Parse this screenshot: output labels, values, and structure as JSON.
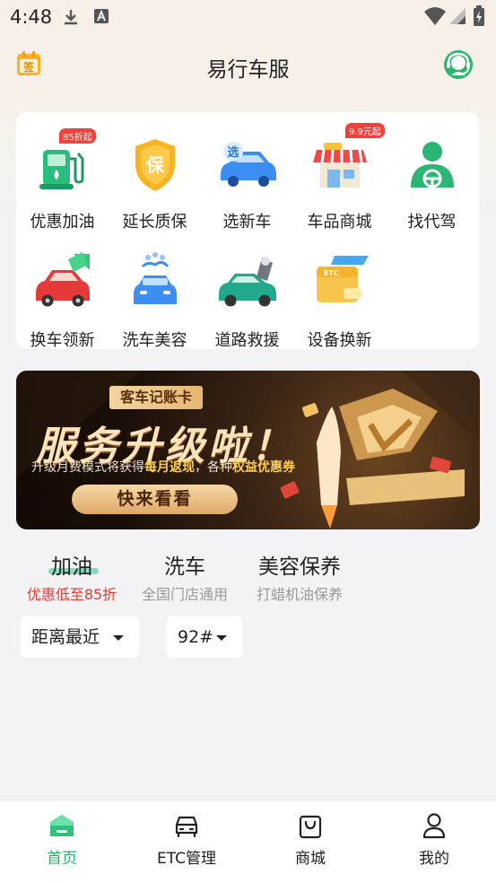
{
  "status_bar": {
    "time": "4:48"
  },
  "header": {
    "title": "易行车服",
    "checkin_icon_text": "签"
  },
  "services": [
    {
      "label": "优惠加油",
      "tag": "85折起",
      "icon": "gas-pump-icon"
    },
    {
      "label": "延长质保",
      "tag": "",
      "icon": "shield-icon",
      "glyph": "保"
    },
    {
      "label": "选新车",
      "tag": "",
      "icon": "new-car-icon",
      "glyph": "选"
    },
    {
      "label": "车品商城",
      "tag": "9.9元起",
      "icon": "store-icon"
    },
    {
      "label": "找代驾",
      "tag": "",
      "icon": "driver-icon"
    },
    {
      "label": "换车领新",
      "tag": "",
      "icon": "trade-in-car-icon"
    },
    {
      "label": "洗车美容",
      "tag": "",
      "icon": "car-wash-icon"
    },
    {
      "label": "道路救援",
      "tag": "",
      "icon": "road-rescue-icon"
    },
    {
      "label": "设备换新",
      "tag": "",
      "icon": "etc-device-icon",
      "glyph": "ETC"
    }
  ],
  "banner": {
    "tagline": "客车记账卡",
    "headline": "服务升级啦！",
    "sub_prefix": "升级月费模式将获得",
    "sub_highlight_1": "每月返现",
    "sub_middle": "，各种",
    "sub_highlight_2": "权益优惠券",
    "cta": "快来看看"
  },
  "categories": [
    {
      "title": "加油",
      "subtitle": "优惠低至85折",
      "active": true
    },
    {
      "title": "洗车",
      "subtitle": "全国门店通用",
      "active": false
    },
    {
      "title": "美容保养",
      "subtitle": "打蜡机油保养",
      "active": false
    }
  ],
  "filters": {
    "sort": "距离最近",
    "fuel": "92#"
  },
  "nav": [
    {
      "label": "首页",
      "icon": "home-icon",
      "active": true
    },
    {
      "label": "ETC管理",
      "icon": "car-front-icon",
      "active": false
    },
    {
      "label": "商城",
      "icon": "shopping-bag-icon",
      "active": false
    },
    {
      "label": "我的",
      "icon": "user-icon",
      "active": false
    }
  ],
  "colors": {
    "accent_green": "#22b46a",
    "tag_red": "#f0413a",
    "promo_red": "#e83a33"
  }
}
